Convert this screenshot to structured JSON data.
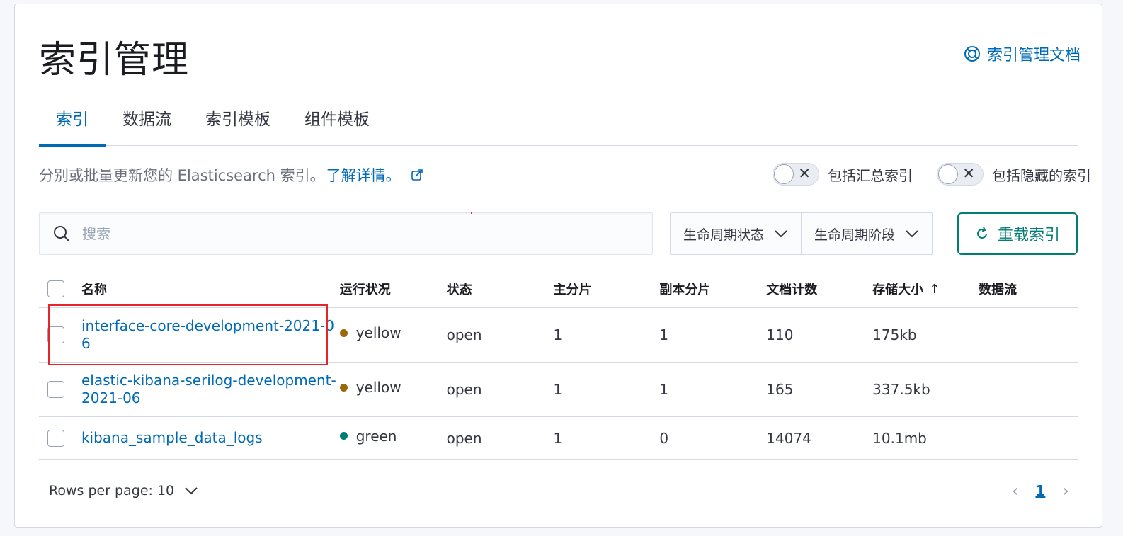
{
  "header": {
    "title": "索引管理",
    "docs_link": "索引管理文档"
  },
  "tabs": [
    {
      "label": "索引",
      "active": true
    },
    {
      "label": "数据流",
      "active": false
    },
    {
      "label": "索引模板",
      "active": false
    },
    {
      "label": "组件模板",
      "active": false
    }
  ],
  "description": {
    "text": "分别或批量更新您的 Elasticsearch 索引。",
    "learn_more": "了解详情。"
  },
  "toggles": {
    "rollup_label": "包括汇总索引",
    "hidden_label": "包括隐藏的索引"
  },
  "search": {
    "placeholder": "搜索"
  },
  "filters": {
    "lifecycle_status": "生命周期状态",
    "lifecycle_phase": "生命周期阶段"
  },
  "reload_button": "重载索引",
  "table": {
    "columns": [
      "名称",
      "运行状况",
      "状态",
      "主分片",
      "副本分片",
      "文档计数",
      "存储大小",
      "数据流"
    ],
    "rows": [
      {
        "name": "interface-core-development-2021-06",
        "health": "yellow",
        "status": "open",
        "primary": "1",
        "replica": "1",
        "docs": "110",
        "size": "175kb"
      },
      {
        "name": "elastic-kibana-serilog-development-2021-06",
        "health": "yellow",
        "status": "open",
        "primary": "1",
        "replica": "1",
        "docs": "165",
        "size": "337.5kb"
      },
      {
        "name": "kibana_sample_data_logs",
        "health": "green",
        "status": "open",
        "primary": "1",
        "replica": "0",
        "docs": "14074",
        "size": "10.1mb"
      }
    ]
  },
  "colors": {
    "yellow": "#9a6a0a",
    "green": "#017d73",
    "accent": "#006bb4"
  },
  "pagination": {
    "rows_per_page": "Rows per page: 10",
    "current_page": "1"
  }
}
